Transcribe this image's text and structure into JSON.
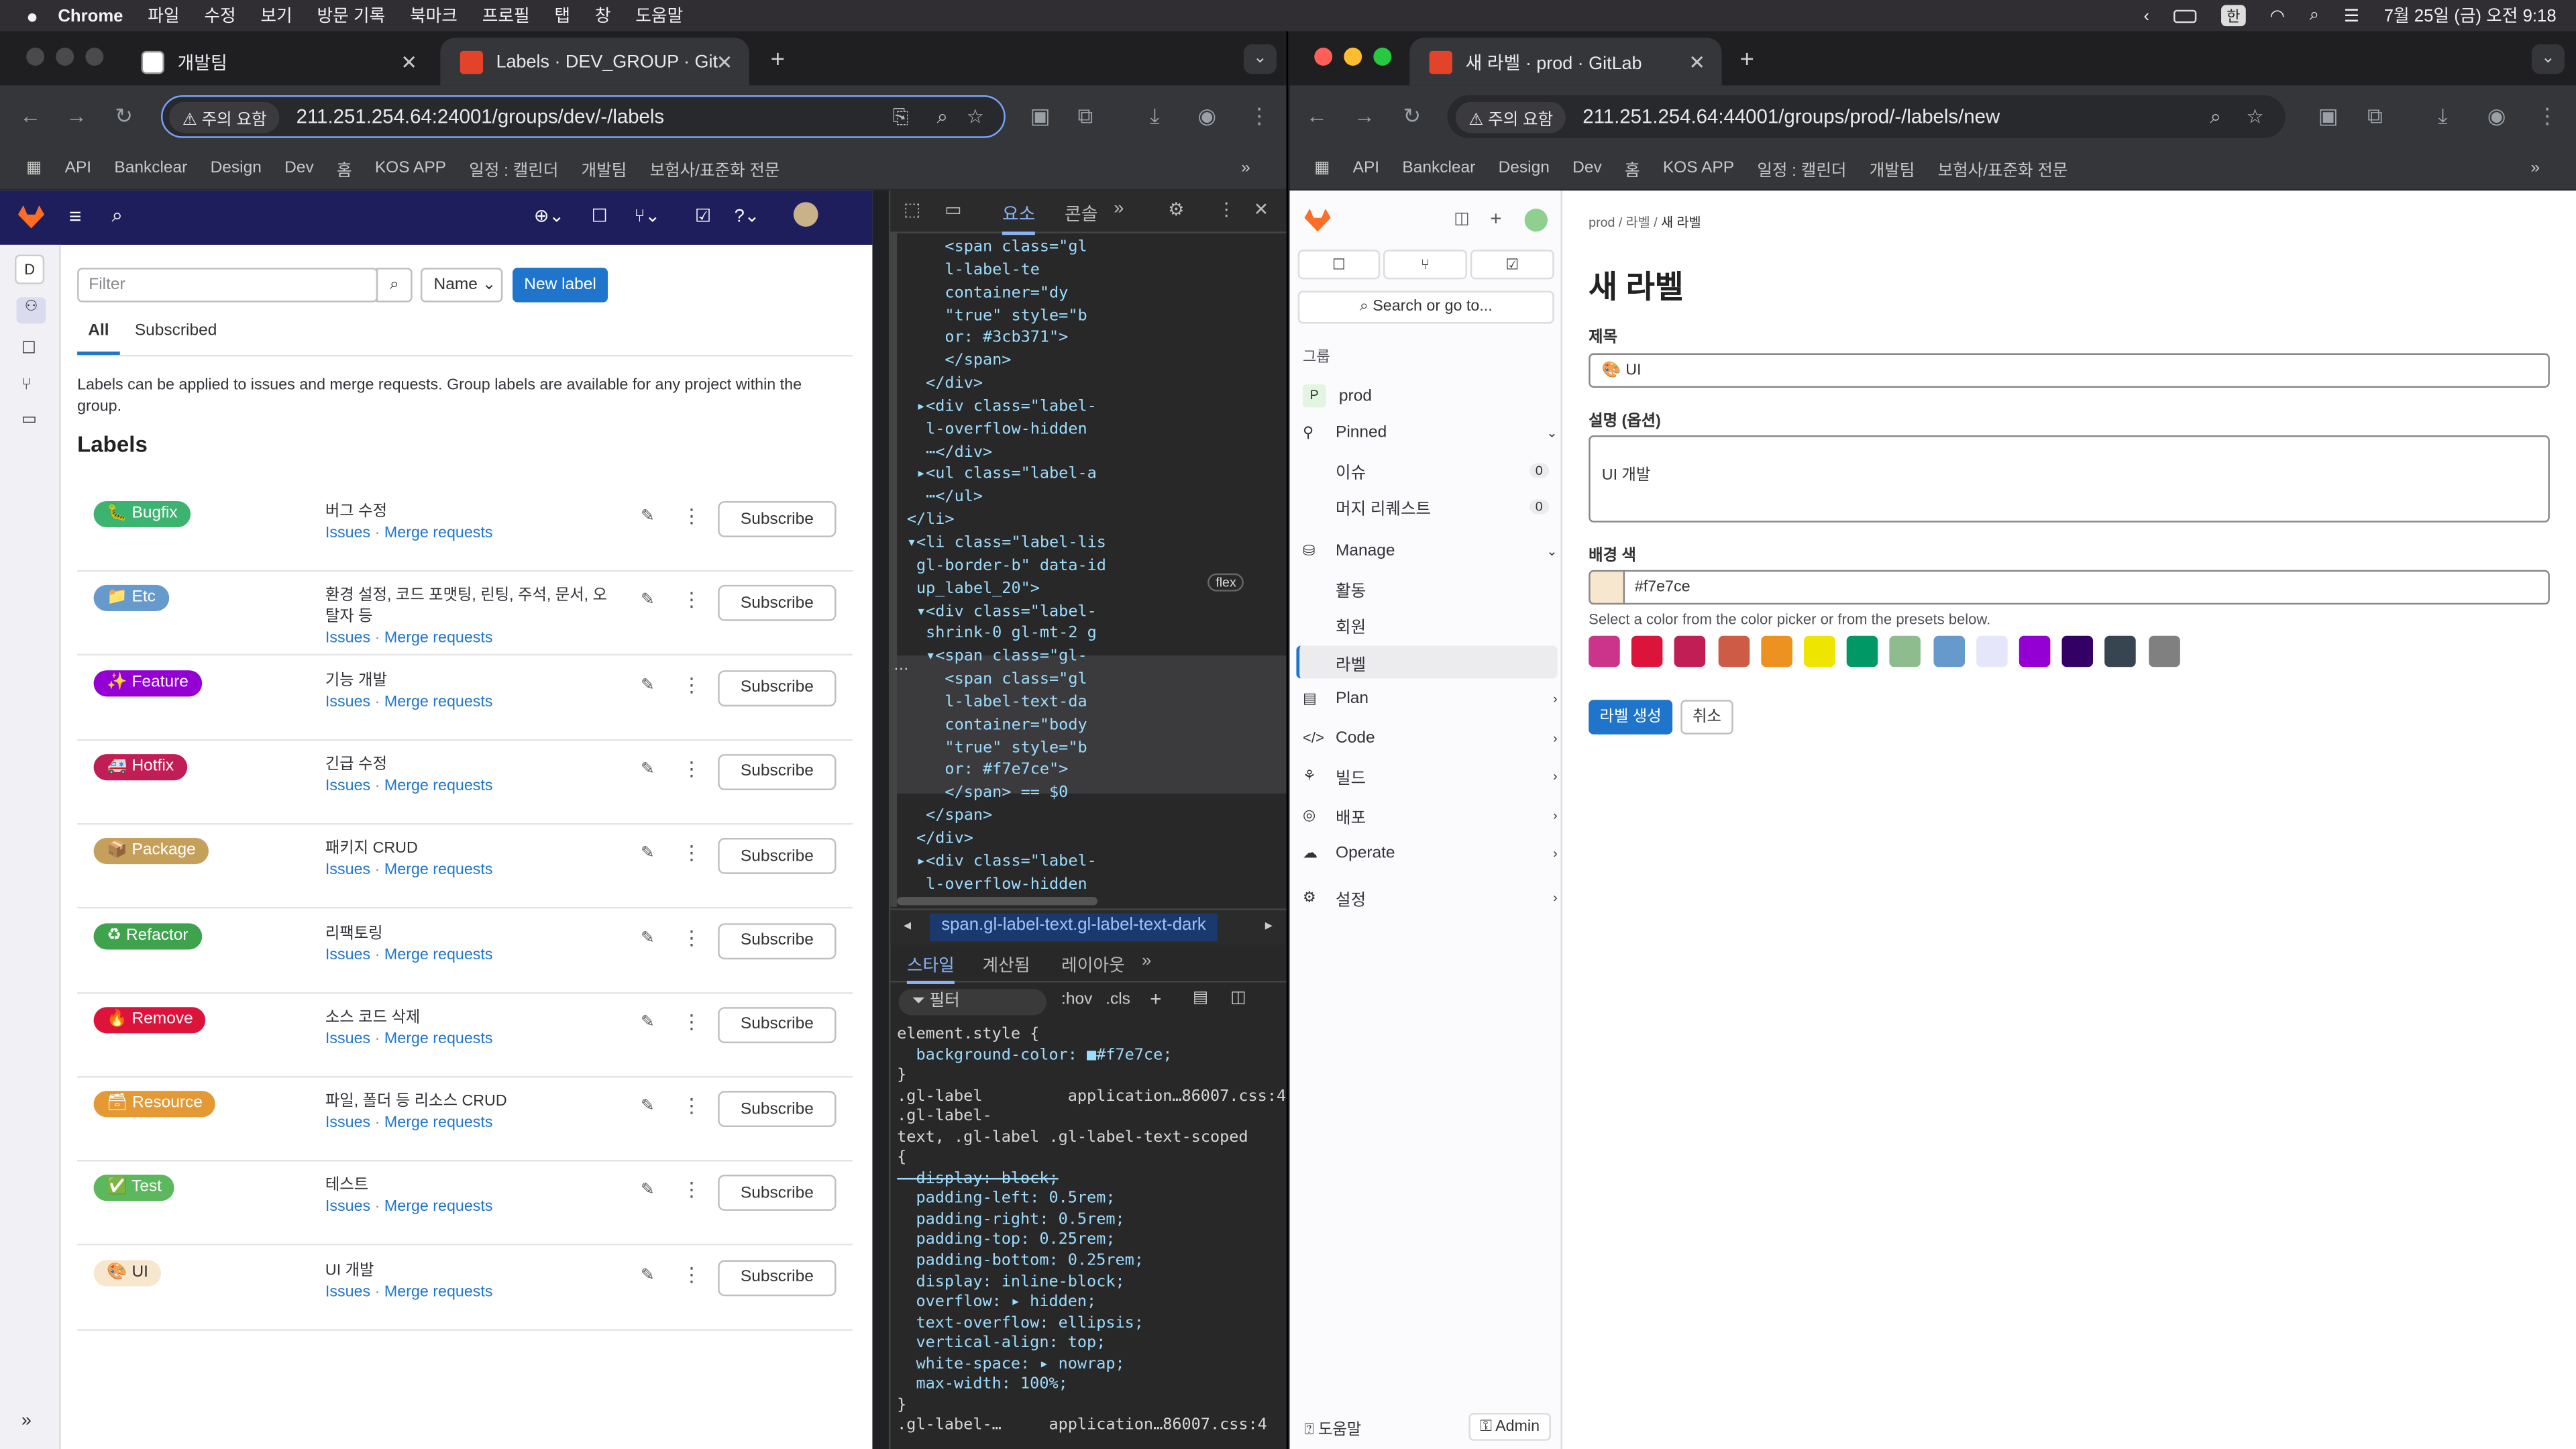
{
  "menubar": {
    "app": "Chrome",
    "items": [
      "파일",
      "수정",
      "보기",
      "방문 기록",
      "북마크",
      "프로필",
      "탭",
      "창",
      "도움말"
    ],
    "datetime": "7월 25일 (금) 오전 9:18",
    "ime": "한"
  },
  "left_window": {
    "tabs": [
      {
        "title": "개발팀"
      },
      {
        "title": "Labels · DEV_GROUP · GitLab"
      }
    ],
    "url": "211.251.254.64:24001/groups/dev/-/labels",
    "security": "주의 요함",
    "bookmarks": [
      "API",
      "Bankclear",
      "Design",
      "Dev",
      "홈",
      "KOS APP",
      "일정 : 캘린더",
      "개발팀",
      "보험사/표준화 전문"
    ],
    "gitlab": {
      "filter_placeholder": "Filter",
      "sort": "Name",
      "new_label": "New label",
      "tabs": [
        "All",
        "Subscribed"
      ],
      "info": "Labels can be applied to issues and merge requests. Group labels are available for any project within the group.",
      "heading": "Labels",
      "issues": "Issues",
      "merge_requests": "Merge requests",
      "sep": "·",
      "subscribe": "Subscribe",
      "avatar_letter": "D",
      "labels": [
        {
          "name": "Bugfix",
          "emoji": "🐛",
          "color": "#3cb371",
          "text": "#ffffff",
          "desc": "버그 수정"
        },
        {
          "name": "Etc",
          "emoji": "📁",
          "color": "#6699cc",
          "text": "#ffffff",
          "desc": "환경 설정, 코드 포맷팅, 린팅, 주석, 문서, 오탈자 등"
        },
        {
          "name": "Feature",
          "emoji": "✨",
          "color": "#9400d3",
          "text": "#ffffff",
          "desc": "기능 개발"
        },
        {
          "name": "Hotfix",
          "emoji": "🚑",
          "color": "#c21e56",
          "text": "#ffffff",
          "desc": "긴급 수정"
        },
        {
          "name": "Package",
          "emoji": "📦",
          "color": "#c5a05a",
          "text": "#ffffff",
          "desc": "패키지 CRUD"
        },
        {
          "name": "Refactor",
          "emoji": "♻",
          "color": "#3fa34d",
          "text": "#ffffff",
          "desc": "리팩토링"
        },
        {
          "name": "Remove",
          "emoji": "🔥",
          "color": "#dc143c",
          "text": "#ffffff",
          "desc": "소스 코드 삭제"
        },
        {
          "name": "Resource",
          "emoji": "🗃",
          "color": "#e59935",
          "text": "#ffffff",
          "desc": "파일, 폴더 등 리소스 CRUD"
        },
        {
          "name": "Test",
          "emoji": "✅",
          "color": "#5cb85c",
          "text": "#ffffff",
          "desc": "테스트"
        },
        {
          "name": "UI",
          "emoji": "🎨",
          "color": "#f7e7ce",
          "text": "#333238",
          "desc": "UI 개발"
        }
      ]
    },
    "devtools": {
      "tabs": [
        "요소",
        "콘솔"
      ],
      "code_lines": [
        "    <span class=\"gl",
        "    l-label-te",
        "    container=\"dy",
        "    \"true\" style=\"b",
        "    or: #3cb371\">",
        "    </span>",
        "  </div>",
        " ▸<div class=\"label-",
        "  l-overflow-hidden",
        "  ⋯</div>",
        " ▸<ul class=\"label-a",
        "  ⋯</ul>",
        "</li>",
        "▾<li class=\"label-lis",
        " gl-border-b\" data-id",
        " up_label_20\">",
        " ▾<div class=\"label-",
        "  shrink-0 gl-mt-2 g",
        "  ▾<span class=\"gl-",
        "    <span class=\"gl",
        "    l-label-text-da",
        "    container=\"body",
        "    \"true\" style=\"b",
        "    or: #f7e7ce\">",
        "    </span> == $0",
        "  </span>",
        " </div>",
        " ▸<div class=\"label-",
        "  l-overflow-hidden"
      ],
      "flex_badge": "flex",
      "breadcrumb": "span.gl-label-text.gl-label-text-dark",
      "style_tabs": [
        "스타일",
        "계산됨",
        "레이아웃"
      ],
      "filter": "필터",
      "hov": ":hov",
      "cls": ".cls",
      "css_lines": [
        "element.style {",
        "  background-color: ■#f7e7ce;",
        "}",
        ".gl-label         application…86007.css:4",
        ".gl-label-",
        "text, .gl-label .gl-label-text-scoped",
        "{",
        "  display: block;",
        "  padding-left: 0.5rem;",
        "  padding-right: 0.5rem;",
        "  padding-top: 0.25rem;",
        "  padding-bottom: 0.25rem;",
        "  display: inline-block;",
        "  overflow: ▸ hidden;",
        "  text-overflow: ellipsis;",
        "  vertical-align: top;",
        "  white-space: ▸ nowrap;",
        "  max-width: 100%;",
        "}",
        ".gl-label-…     application…86007.css:4"
      ]
    }
  },
  "right_window": {
    "tabs": [
      {
        "title": "새 라벨 · prod · GitLab"
      }
    ],
    "url": "211.251.254.64:44001/groups/prod/-/labels/new",
    "security": "주의 요함",
    "bookmarks": [
      "API",
      "Bankclear",
      "Design",
      "Dev",
      "홈",
      "KOS APP",
      "일정 : 캘린더",
      "개발팀",
      "보험사/표준화 전문"
    ],
    "sidebar": {
      "search": "Search or go to...",
      "group_heading": "그룹",
      "group": "prod",
      "group_letter": "P",
      "pinned": "Pinned",
      "pinned_items": [
        {
          "label": "이슈",
          "count": "0"
        },
        {
          "label": "머지 리퀘스트",
          "count": "0"
        }
      ],
      "manage": "Manage",
      "manage_items": [
        "활동",
        "회원",
        "라벨"
      ],
      "sections": [
        "Plan",
        "Code",
        "빌드",
        "배포",
        "Operate",
        "설정"
      ],
      "help": "도움말",
      "admin": "Admin"
    },
    "breadcrumb": [
      "prod",
      "라벨",
      "새 라벨"
    ],
    "title": "새 라벨",
    "form": {
      "title_label": "제목",
      "title_value": "🎨 UI",
      "desc_label": "설명 (옵션)",
      "desc_value": "UI 개발",
      "color_label": "배경 색",
      "color_value": "#f7e7ce",
      "hint": "Select a color from the color picker or from the presets below.",
      "presets": [
        "#cc338b",
        "#dc143c",
        "#c21e56",
        "#cd5b45",
        "#ed9121",
        "#eee600",
        "#009966",
        "#8fbc8f",
        "#6699cc",
        "#e6e6fa",
        "#9400d3",
        "#330066",
        "#36454f",
        "#808080"
      ],
      "create": "라벨 생성",
      "cancel": "취소"
    }
  }
}
